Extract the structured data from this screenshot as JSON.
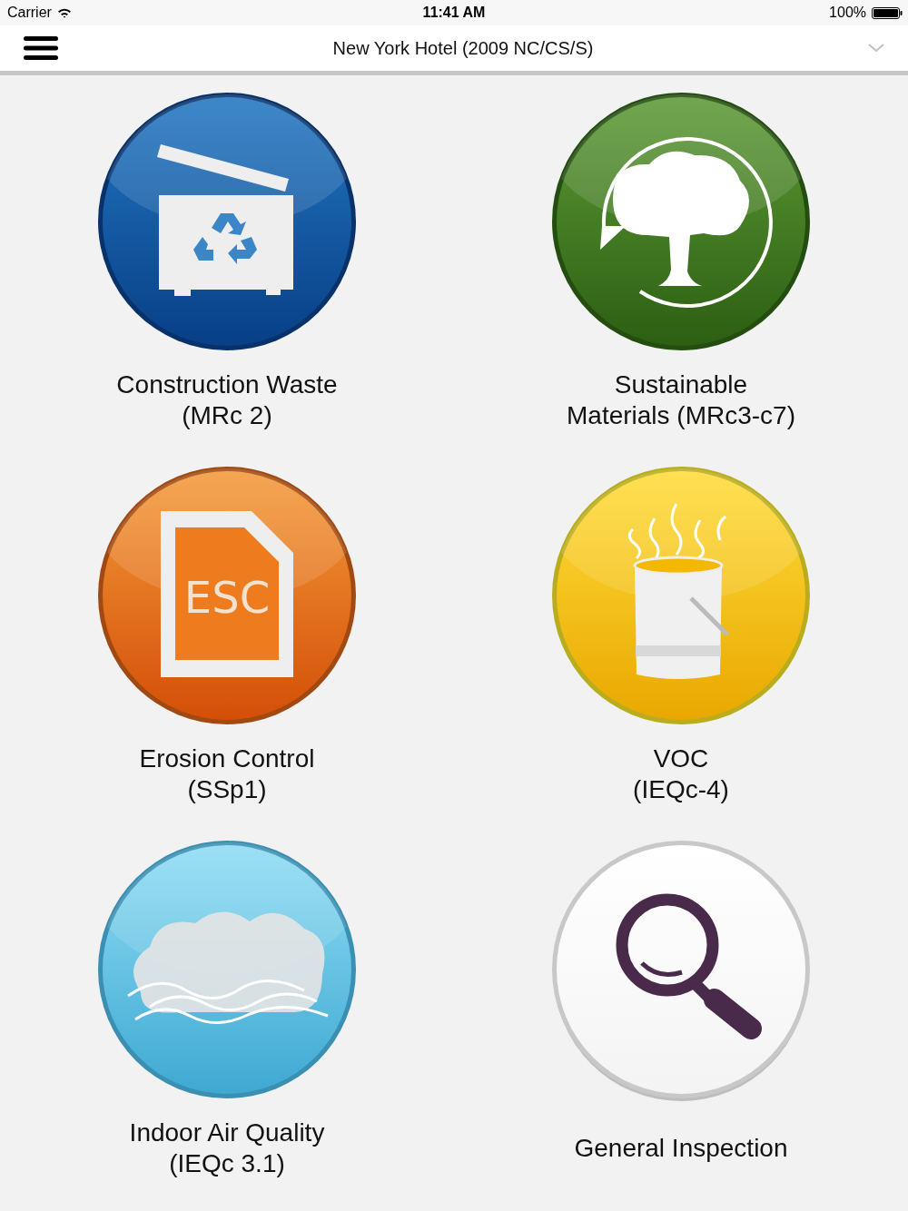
{
  "status_bar": {
    "carrier": "Carrier",
    "time": "11:41 AM",
    "battery": "100%"
  },
  "nav_bar": {
    "title": "New York Hotel (2009 NC/CS/S)"
  },
  "tiles": [
    {
      "kind": "dumpster",
      "label_lines": [
        "Construction Waste",
        "(MRc 2)"
      ]
    },
    {
      "kind": "tree",
      "label_lines": [
        "Sustainable",
        "Materials (MRc3-c7)"
      ]
    },
    {
      "kind": "document",
      "icon_text": "ESC",
      "label_lines": [
        "Erosion Control",
        "(SSp1)"
      ]
    },
    {
      "kind": "bucket",
      "label_lines": [
        "VOC",
        "(IEQc-4)"
      ]
    },
    {
      "kind": "cloud",
      "label_lines": [
        "Indoor Air Quality",
        "(IEQc 3.1)"
      ]
    },
    {
      "kind": "search",
      "label_lines": [
        "General Inspection"
      ]
    }
  ]
}
